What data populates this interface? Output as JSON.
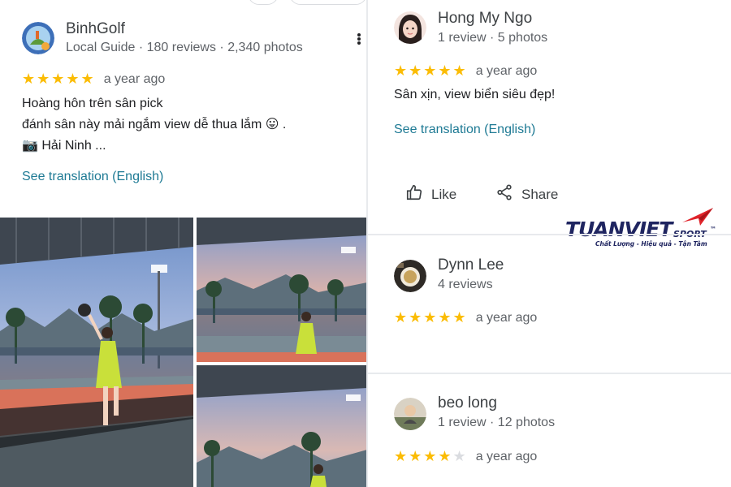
{
  "left_review": {
    "reviewer_name": "BinhGolf",
    "reviewer_meta": "Local Guide · 180 reviews · 2,340 photos",
    "rating": 5,
    "stars": "★★★★★",
    "time": "a year ago",
    "lines": [
      "Hoàng hôn trên sân pick",
      "đánh sân này mải ngắm view dễ thua lắm 😛 .",
      "📷 Hải Ninh ..."
    ],
    "translation_link": "See translation (English)",
    "more_icon": "more-vert-icon"
  },
  "right_reviews": [
    {
      "reviewer_name": "Hong My Ngo",
      "reviewer_meta": "1 review · 5 photos",
      "rating": 5,
      "stars": "★★★★★",
      "time": "a year ago",
      "text": "Sân xịn, view biển siêu đẹp!",
      "translation_link": "See translation (English)",
      "like_label": "Like",
      "share_label": "Share"
    },
    {
      "reviewer_name": "Dynn Lee",
      "reviewer_meta": "4 reviews",
      "rating": 5,
      "stars": "★★★★★",
      "time": "a year ago"
    },
    {
      "reviewer_name": "beo long",
      "reviewer_meta": "1 review · 12 photos",
      "rating": 4,
      "stars_filled": "★★★★",
      "stars_empty": "★",
      "time": "a year ago"
    }
  ],
  "watermark": {
    "brand": "TUANVIET",
    "sport": "SPORT",
    "tm": "™",
    "tagline": "Chất Lượng - Hiệu quả - Tận Tâm"
  },
  "colors": {
    "star": "#fbbc04",
    "link": "#1e7a94",
    "brand_navy": "#1f2560",
    "brand_red": "#e0232a"
  }
}
